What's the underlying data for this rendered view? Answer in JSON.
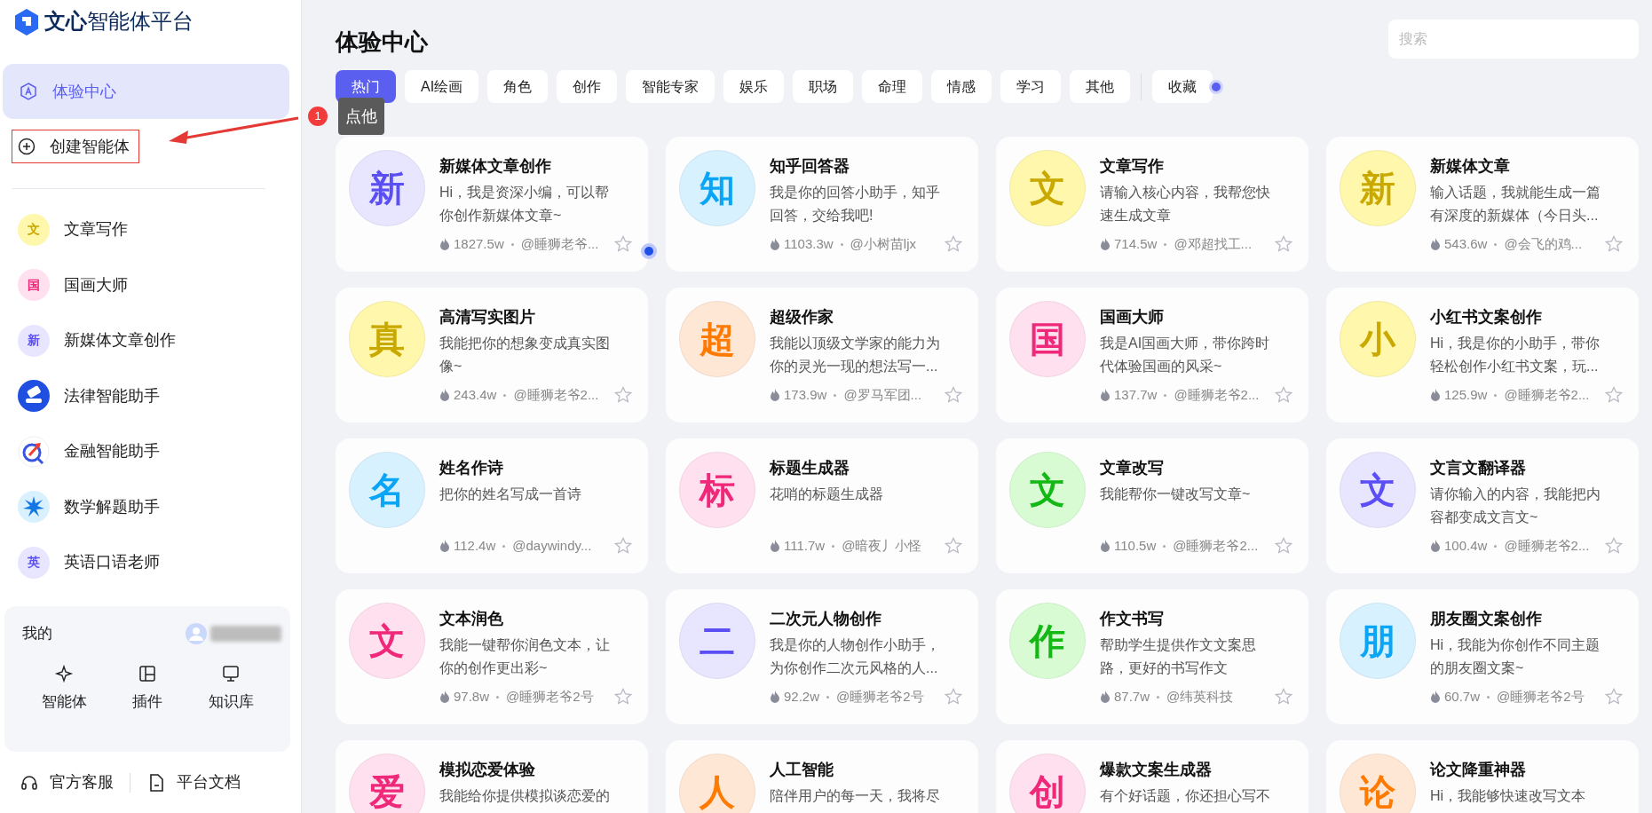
{
  "logo": {
    "brand": "文心",
    "product": "智能体平台"
  },
  "sidebar": {
    "nav": [
      {
        "label": "体验中心",
        "selected": true,
        "kind": "center"
      },
      {
        "label": "创建智能体",
        "selected": false,
        "kind": "create"
      }
    ],
    "recent": [
      {
        "label": "文章写作",
        "kind": "letter",
        "avatar": "文",
        "color": "#c9a800"
      },
      {
        "label": "国画大师",
        "kind": "letter",
        "avatar": "国",
        "color": "#f0287a"
      },
      {
        "label": "新媒体文章创作",
        "kind": "letter",
        "avatar": "新",
        "color": "#5b4ef5"
      },
      {
        "label": "法律智能助手",
        "kind": "logo"
      },
      {
        "label": "金融智能助手",
        "kind": "logo"
      },
      {
        "label": "数学解题助手",
        "kind": "logo"
      },
      {
        "label": "英语口语老师",
        "kind": "letter",
        "avatar": "英",
        "color": "#5b4ef5"
      }
    ],
    "mine": {
      "title": "我的",
      "shortcuts": [
        "智能体",
        "插件",
        "知识库"
      ]
    },
    "footer": [
      "官方客服",
      "平台文档"
    ]
  },
  "annotation": {
    "badge": "1",
    "tooltip": "点他"
  },
  "page_title": "体验中心",
  "search": {
    "placeholder": "搜索"
  },
  "tabs": [
    {
      "label": "热门",
      "selected": true
    },
    {
      "label": "AI绘画",
      "selected": false
    },
    {
      "label": "角色",
      "selected": false
    },
    {
      "label": "创作",
      "selected": false
    },
    {
      "label": "智能专家",
      "selected": false
    },
    {
      "label": "娱乐",
      "selected": false
    },
    {
      "label": "职场",
      "selected": false
    },
    {
      "label": "命理",
      "selected": false
    },
    {
      "label": "情感",
      "selected": false
    },
    {
      "label": "学习",
      "selected": false
    },
    {
      "label": "其他",
      "selected": false
    }
  ],
  "favorites_tab": {
    "label": "收藏",
    "selected": false
  },
  "cards": [
    {
      "avatar": "新",
      "color": "#5b4ef5",
      "title": "新媒体文章创作",
      "desc": "Hi，我是资深小编，可以帮你创作新媒体文章~",
      "views": "1827.5w",
      "author": "@睡狮老爷...",
      "favorited": false
    },
    {
      "avatar": "知",
      "color": "#0aa5f5",
      "title": "知乎回答器",
      "desc": "我是你的回答小助手，知乎回答，交给我吧!",
      "views": "1103.3w",
      "author": "@小树苗ljx",
      "favorited": false
    },
    {
      "avatar": "文",
      "color": "#c9a800",
      "title": "文章写作",
      "desc": "请输入核心内容，我帮您快速生成文章",
      "views": "714.5w",
      "author": "@邓超找工...",
      "favorited": false
    },
    {
      "avatar": "新",
      "color": "#c9a800",
      "title": "新媒体文章",
      "desc": "输入话题，我就能生成一篇有深度的新媒体（今日头...",
      "views": "543.6w",
      "author": "@会飞的鸡...",
      "favorited": false
    },
    {
      "avatar": "真",
      "color": "#c9a800",
      "title": "高清写实图片",
      "desc": "我能把你的想象变成真实图像~",
      "views": "243.4w",
      "author": "@睡狮老爷2...",
      "favorited": false
    },
    {
      "avatar": "超",
      "color": "#ff7a00",
      "title": "超级作家",
      "desc": "我能以顶级文学家的能力为你的灵光一现的想法写一...",
      "views": "173.9w",
      "author": "@罗马军团...",
      "favorited": false
    },
    {
      "avatar": "国",
      "color": "#f0287a",
      "title": "国画大师",
      "desc": "我是AI国画大师，带你跨时代体验国画的风采~",
      "views": "137.7w",
      "author": "@睡狮老爷2...",
      "favorited": false
    },
    {
      "avatar": "小",
      "color": "#c9a800",
      "title": "小红书文案创作",
      "desc": "Hi，我是你的小助手，带你轻松创作小红书文案，玩...",
      "views": "125.9w",
      "author": "@睡狮老爷2...",
      "favorited": false
    },
    {
      "avatar": "名",
      "color": "#0aa5f5",
      "title": "姓名作诗",
      "desc": "把你的姓名写成一首诗",
      "views": "112.4w",
      "author": "@daywindy...",
      "favorited": false
    },
    {
      "avatar": "标",
      "color": "#f0287a",
      "title": "标题生成器",
      "desc": "花哨的标题生成器",
      "views": "111.7w",
      "author": "@暗夜丿小怪",
      "favorited": false
    },
    {
      "avatar": "文",
      "color": "#14b814",
      "title": "文章改写",
      "desc": "我能帮你一键改写文章~",
      "views": "110.5w",
      "author": "@睡狮老爷2...",
      "favorited": false
    },
    {
      "avatar": "文",
      "color": "#5b4ef5",
      "title": "文言文翻译器",
      "desc": "请你输入的内容，我能把内容都变成文言文~",
      "views": "100.4w",
      "author": "@睡狮老爷2...",
      "favorited": false
    },
    {
      "avatar": "文",
      "color": "#f0287a",
      "title": "文本润色",
      "desc": "我能一键帮你润色文本，让你的创作更出彩~",
      "views": "97.8w",
      "author": "@睡狮老爷2号",
      "favorited": false
    },
    {
      "avatar": "二",
      "color": "#5b4ef5",
      "title": "二次元人物创作",
      "desc": "我是你的人物创作小助手，为你创作二次元风格的人...",
      "views": "92.2w",
      "author": "@睡狮老爷2号",
      "favorited": false
    },
    {
      "avatar": "作",
      "color": "#14b814",
      "title": "作文书写",
      "desc": "帮助学生提供作文文案思路，更好的书写作文",
      "views": "87.7w",
      "author": "@纬英科技",
      "favorited": false
    },
    {
      "avatar": "朋",
      "color": "#0aa5f5",
      "title": "朋友圈文案创作",
      "desc": "Hi，我能为你创作不同主题的朋友圈文案~",
      "views": "60.7w",
      "author": "@睡狮老爷2号",
      "favorited": false
    },
    {
      "avatar": "爱",
      "color": "#f0287a",
      "title": "模拟恋爱体验",
      "desc": "我能给你提供模拟谈恋爱的"
    },
    {
      "avatar": "人",
      "color": "#ff7a00",
      "title": "人工智能",
      "desc": "陪伴用户的每一天，我将尽"
    },
    {
      "avatar": "创",
      "color": "#f0287a",
      "title": "爆款文案生成器",
      "desc": "有个好话题，你还担心写不"
    },
    {
      "avatar": "论",
      "color": "#ff7a00",
      "title": "论文降重神器",
      "desc": "Hi，我能够快速改写文本"
    }
  ]
}
